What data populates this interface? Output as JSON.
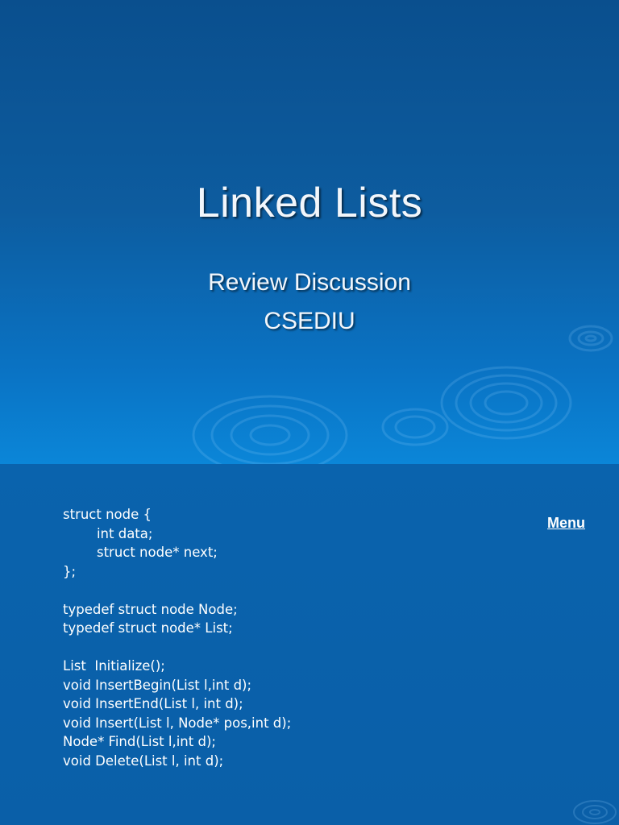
{
  "slide1": {
    "title": "Linked Lists",
    "subtitle_line1": "Review Discussion",
    "subtitle_line2": "CSEDIU"
  },
  "slide2": {
    "code_lines": [
      "struct node {",
      "\t\tint data;",
      "\t\tstruct node* next;",
      "};",
      "",
      "typedef struct node Node;",
      "typedef struct node* List;",
      "",
      "List  Initialize();",
      "void InsertBegin(List l,int d);",
      "void InsertEnd(List l, int d);",
      "void Insert(List l, Node* pos,int d);",
      "Node* Find(List l,int d);",
      "void Delete(List l, int d);"
    ],
    "menu_label": "Menu"
  },
  "colors": {
    "background_top": "#0a4f8e",
    "background_bottom": "#0b86d8",
    "text": "#ffffff"
  }
}
